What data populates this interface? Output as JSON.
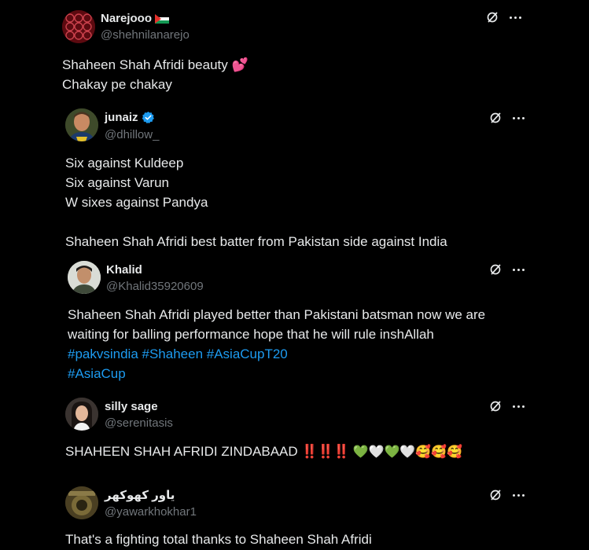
{
  "posts": [
    {
      "name": "Narejooo",
      "handle": "@shehnilanarejo",
      "lines": [
        "Shaheen Shah Afridi beauty 💕",
        "Chakay pe chakay"
      ]
    },
    {
      "name": "junaiz",
      "handle": "@dhillow_",
      "lines": [
        "Six against Kuldeep",
        "Six against Varun",
        "W sixes against Pandya",
        "",
        "Shaheen Shah Afridi best batter from Pakistan side against India"
      ]
    },
    {
      "name": "Khalid",
      "handle": "@Khalid35920609",
      "lines": [
        "Shaheen Shah Afridi played better than Pakistani batsman now we are",
        "waiting for balling performance hope that he will rule inshAllah"
      ],
      "hashtags_line1": "#pakvsindia #Shaheen #AsiaCupT20",
      "hashtags_line2": "#AsiaCup"
    },
    {
      "name": "silly sage",
      "handle": "@serenitasis",
      "text": "SHAHEEN SHAH AFRIDI ZINDABAAD ",
      "bangs": "‼️‼️‼️",
      "emojis": "💚🤍💚🤍🥰🥰🥰"
    },
    {
      "name": "یاور کھوکھر",
      "handle": "@yawarkhokhar1",
      "lines": [
        "That's a fighting total thanks to Shaheen Shah Afridi"
      ]
    }
  ],
  "icons": {
    "grok": "grok-icon",
    "more": "more-icon",
    "verified": "verified-badge-icon",
    "flag": "palestine-flag-icon"
  },
  "colors": {
    "background": "#000000",
    "text": "#e7e9ea",
    "secondary": "#71767b",
    "link": "#1d9bf0",
    "verified": "#1d9bf0"
  }
}
